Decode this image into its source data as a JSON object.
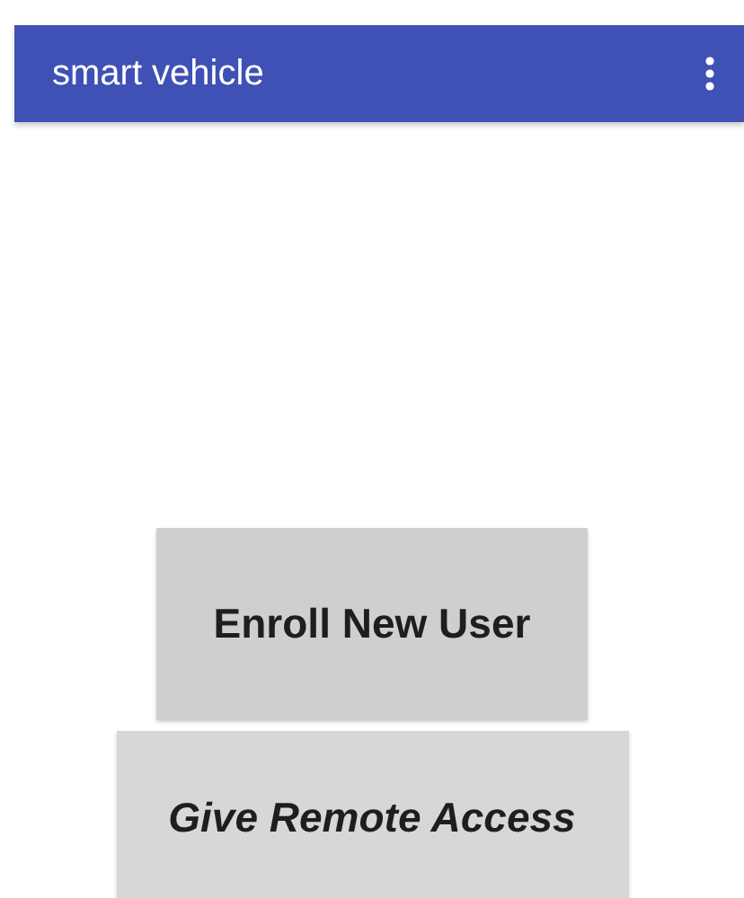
{
  "app_bar": {
    "title": "smart vehicle"
  },
  "buttons": [
    {
      "label": "Enroll New User",
      "kind": "plain"
    },
    {
      "label": "Give Remote Access",
      "kind": "italic"
    }
  ]
}
